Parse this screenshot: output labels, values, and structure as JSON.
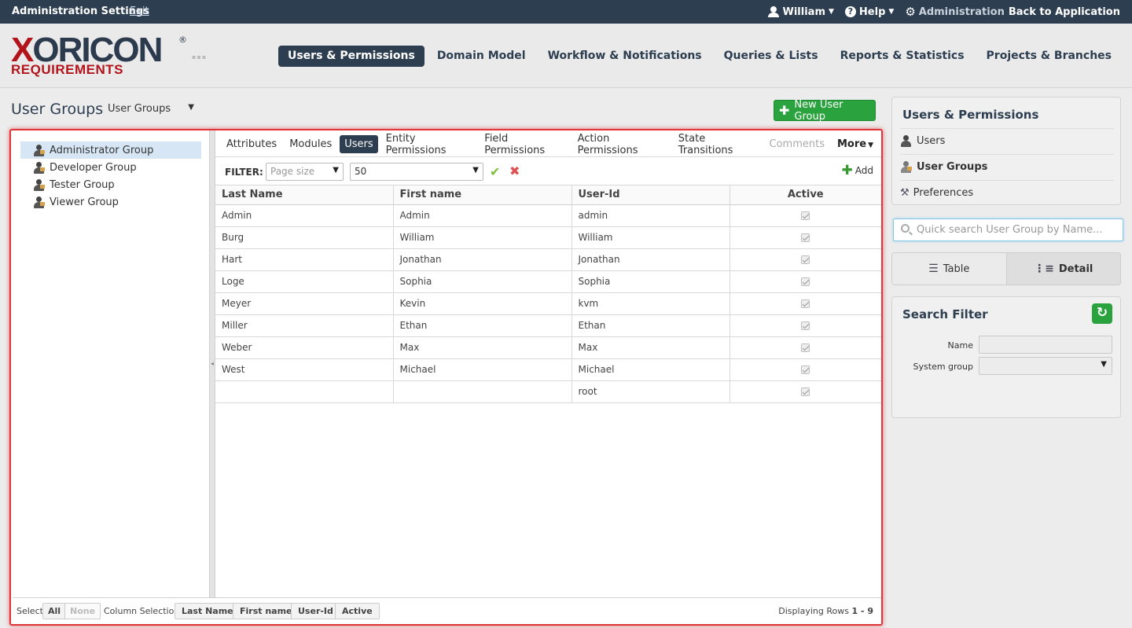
{
  "topbar": {
    "title": "Administration Settings",
    "exit_link": "Exit",
    "user_menu": "William",
    "help_menu": "Help",
    "admin_label": "Administration",
    "back_label": "Back to Application"
  },
  "logo": {
    "brand_first": "X",
    "brand_rest": "ORICON",
    "registered": "®",
    "subtitle": "REQUIREMENTS"
  },
  "mainnav": {
    "items": [
      {
        "label": "Users & Permissions",
        "active": true
      },
      {
        "label": "Domain Model"
      },
      {
        "label": "Workflow & Notifications"
      },
      {
        "label": "Queries & Lists"
      },
      {
        "label": "Reports & Statistics"
      },
      {
        "label": "Projects & Branches"
      }
    ]
  },
  "page": {
    "title": "User Groups",
    "dropdown_value": "User Groups",
    "new_button": "New User Group"
  },
  "tree": {
    "items": [
      {
        "label": "Administrator Group",
        "selected": true
      },
      {
        "label": "Developer Group"
      },
      {
        "label": "Tester Group"
      },
      {
        "label": "Viewer Group"
      }
    ]
  },
  "tabs": {
    "items": [
      {
        "label": "Attributes"
      },
      {
        "label": "Modules"
      },
      {
        "label": "Users",
        "active": true
      },
      {
        "label": "Entity Permissions"
      },
      {
        "label": "Field Permissions"
      },
      {
        "label": "Action Permissions"
      },
      {
        "label": "State Transitions"
      },
      {
        "label": "Comments",
        "disabled": true
      }
    ],
    "more": "More"
  },
  "filter": {
    "label": "FILTER:",
    "page_size_placeholder": "Page size",
    "value": "50",
    "add_label": "Add"
  },
  "table": {
    "columns": [
      "Last Name",
      "First name",
      "User-Id",
      "Active"
    ],
    "rows": [
      {
        "last": "Admin",
        "first": "Admin",
        "userid": "admin",
        "active": true
      },
      {
        "last": "Burg",
        "first": "William",
        "userid": "William",
        "active": true
      },
      {
        "last": "Hart",
        "first": "Jonathan",
        "userid": "Jonathan",
        "active": true
      },
      {
        "last": "Loge",
        "first": "Sophia",
        "userid": "Sophia",
        "active": true
      },
      {
        "last": "Meyer",
        "first": "Kevin",
        "userid": "kvm",
        "active": true
      },
      {
        "last": "Miller",
        "first": "Ethan",
        "userid": "Ethan",
        "active": true
      },
      {
        "last": "Weber",
        "first": "Max",
        "userid": "Max",
        "active": true
      },
      {
        "last": "West",
        "first": "Michael",
        "userid": "Michael",
        "active": true
      },
      {
        "last": "",
        "first": "",
        "userid": "root",
        "active": true
      }
    ]
  },
  "footer": {
    "select_label": "Select",
    "all": "All",
    "none": "None",
    "column_selection_label": "Column Selection:",
    "columns": [
      "Last Name",
      "First name",
      "User-Id",
      "Active"
    ],
    "displaying_label": "Displaying Rows",
    "displaying_range": "1 - 9"
  },
  "sidebar": {
    "title": "Users & Permissions",
    "items": [
      {
        "label": "Users"
      },
      {
        "label": "User Groups",
        "active": true
      },
      {
        "label": "Preferences"
      }
    ],
    "search_placeholder": "Quick search User Group by Name...",
    "view_table": "Table",
    "view_detail": "Detail",
    "search_filter_title": "Search Filter",
    "filter_name_label": "Name",
    "filter_system_group_label": "System group"
  },
  "colors": {
    "navy": "#2d3e50",
    "green": "#2aa33f",
    "logo_red": "#b3141b",
    "highlight_red": "#e0363a"
  }
}
